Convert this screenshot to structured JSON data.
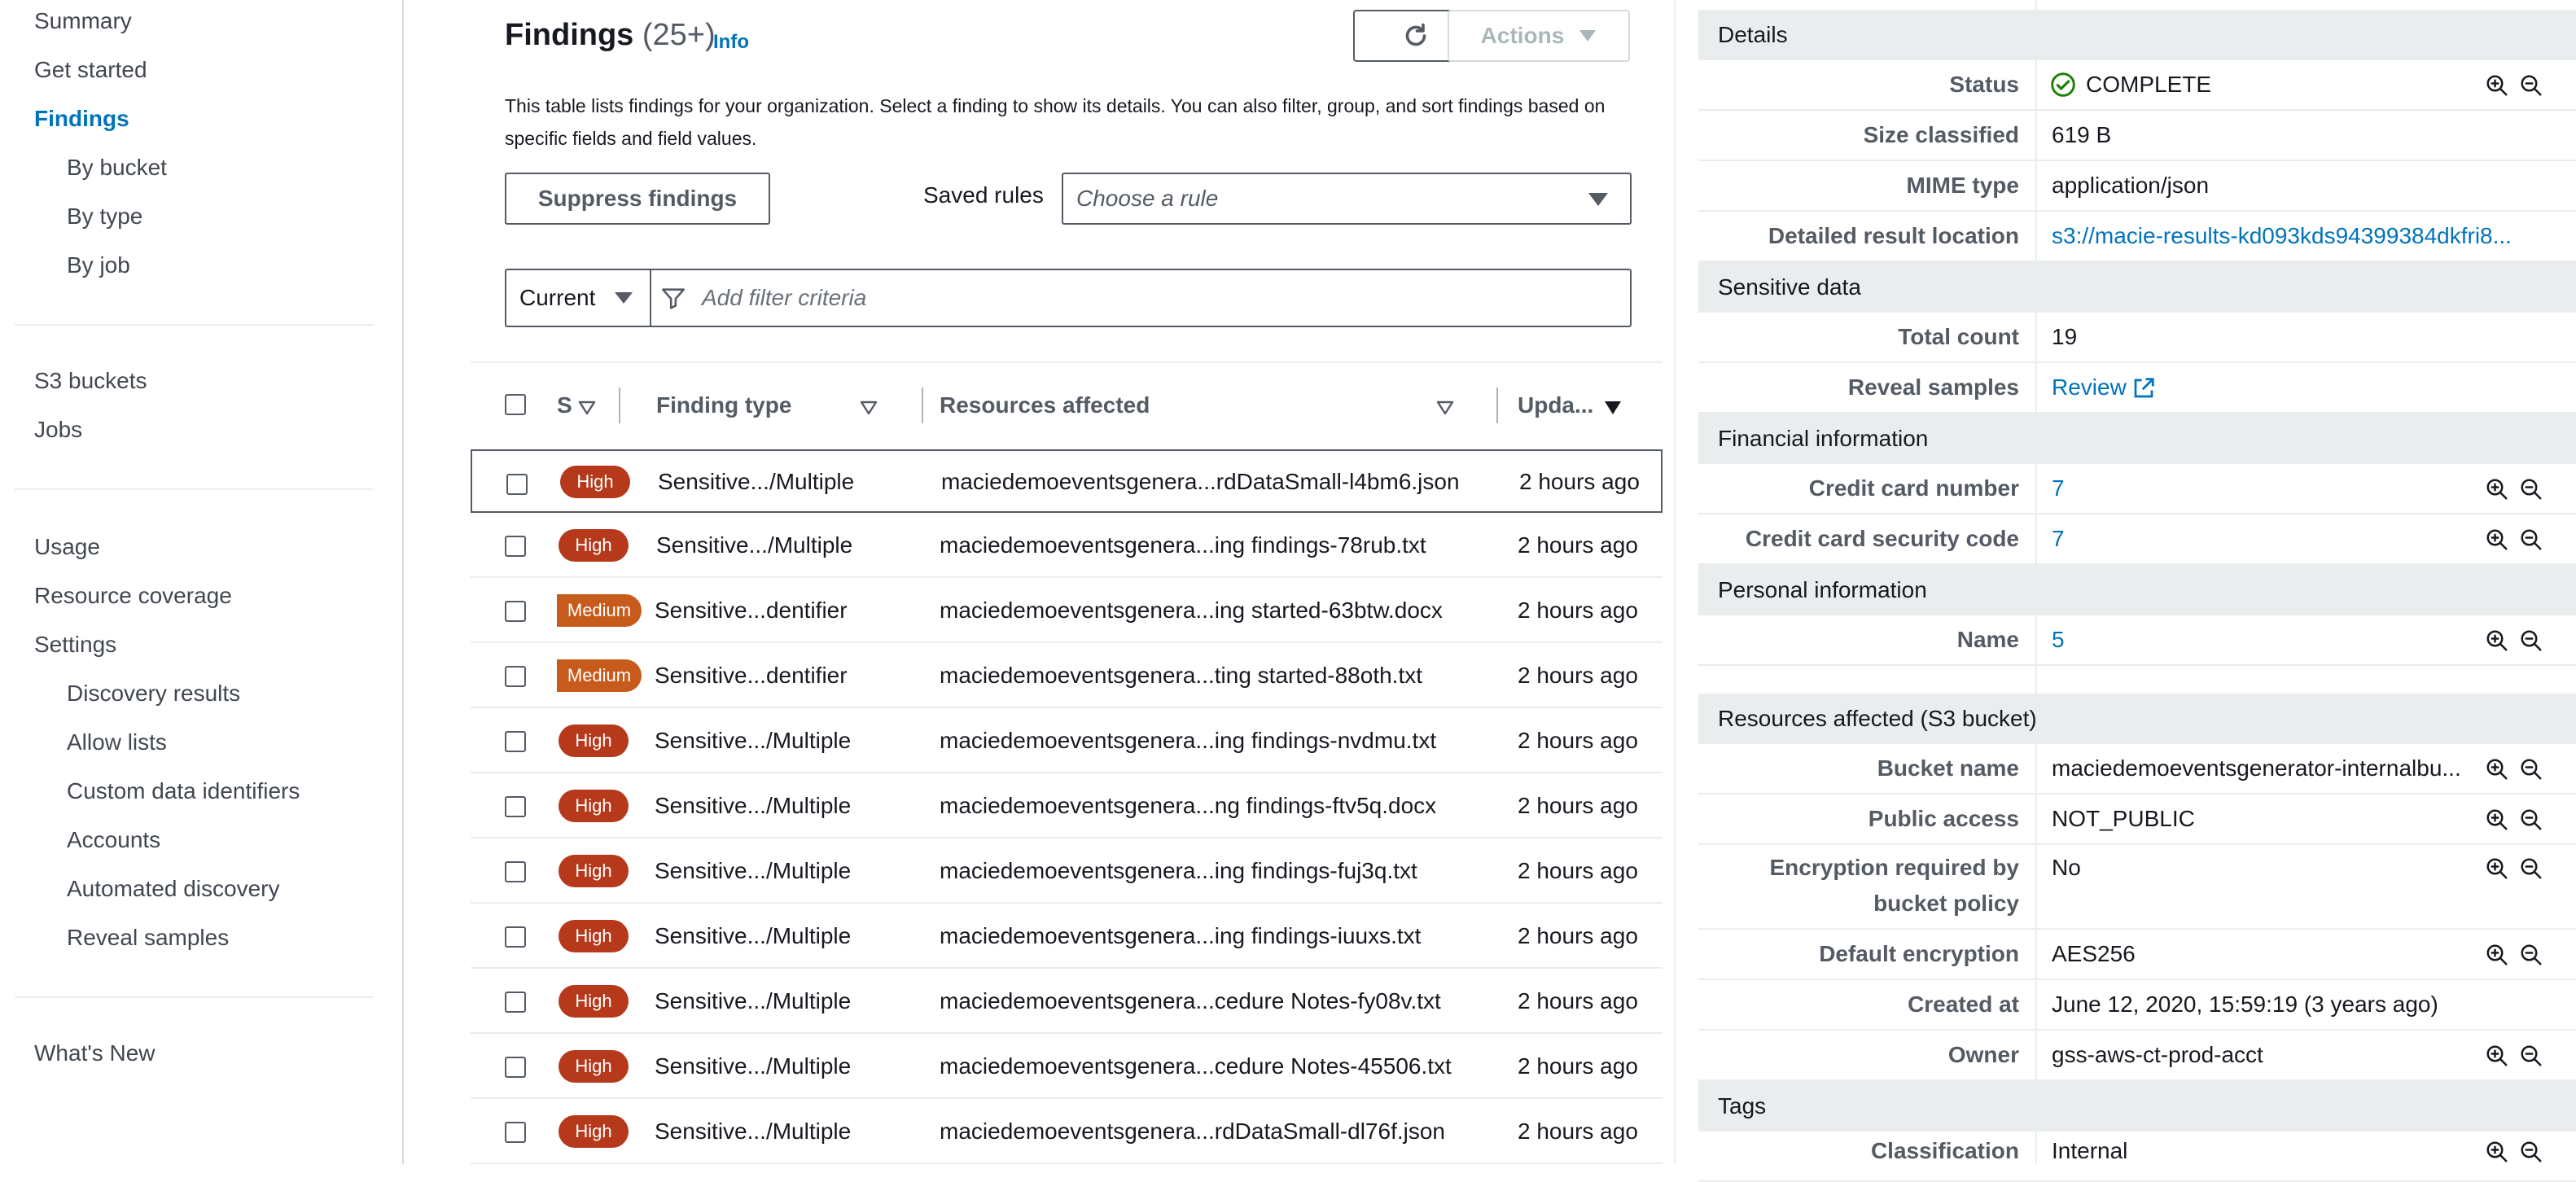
{
  "sidebar": {
    "items": [
      {
        "label": "Summary"
      },
      {
        "label": "Get started"
      },
      {
        "label": "Findings"
      },
      {
        "label": "By bucket"
      },
      {
        "label": "By type"
      },
      {
        "label": "By job"
      },
      {
        "label": "S3 buckets"
      },
      {
        "label": "Jobs"
      },
      {
        "label": "Usage"
      },
      {
        "label": "Resource coverage"
      },
      {
        "label": "Settings"
      },
      {
        "label": "Discovery results"
      },
      {
        "label": "Allow lists"
      },
      {
        "label": "Custom data identifiers"
      },
      {
        "label": "Accounts"
      },
      {
        "label": "Automated discovery"
      },
      {
        "label": "Reveal samples"
      },
      {
        "label": "What's New"
      }
    ]
  },
  "header": {
    "title": "Findings",
    "count": "(25+)",
    "info": "Info",
    "actions_label": "Actions",
    "description": "This table lists findings for your organization. Select a finding to show its details. You can also filter, group, and sort findings based on specific fields and field values."
  },
  "toolbar": {
    "suppress_label": "Suppress findings",
    "saved_rules_label": "Saved rules",
    "rule_placeholder": "Choose a rule",
    "current_label": "Current",
    "filter_placeholder": "Add filter criteria"
  },
  "table": {
    "columns": [
      "S",
      "Finding type",
      "Resources affected",
      "Upda..."
    ],
    "rows": [
      {
        "severity": "High",
        "type": "Sensitive.../Multiple",
        "resource": "maciedemoeventsgenera...rdDataSmall-l4bm6.json",
        "updated": "2 hours ago"
      },
      {
        "severity": "High",
        "type": "Sensitive.../Multiple",
        "resource": "maciedemoeventsgenera...ing findings-78rub.txt",
        "updated": "2 hours ago"
      },
      {
        "severity": "Medium",
        "type": "Sensitive...dentifier",
        "resource": "maciedemoeventsgenera...ing started-63btw.docx",
        "updated": "2 hours ago"
      },
      {
        "severity": "Medium",
        "type": "Sensitive...dentifier",
        "resource": "maciedemoeventsgenera...ting started-88oth.txt",
        "updated": "2 hours ago"
      },
      {
        "severity": "High",
        "type": "Sensitive.../Multiple",
        "resource": "maciedemoeventsgenera...ing findings-nvdmu.txt",
        "updated": "2 hours ago"
      },
      {
        "severity": "High",
        "type": "Sensitive.../Multiple",
        "resource": "maciedemoeventsgenera...ng findings-ftv5q.docx",
        "updated": "2 hours ago"
      },
      {
        "severity": "High",
        "type": "Sensitive.../Multiple",
        "resource": "maciedemoeventsgenera...ing findings-fuj3q.txt",
        "updated": "2 hours ago"
      },
      {
        "severity": "High",
        "type": "Sensitive.../Multiple",
        "resource": "maciedemoeventsgenera...ing findings-iuuxs.txt",
        "updated": "2 hours ago"
      },
      {
        "severity": "High",
        "type": "Sensitive.../Multiple",
        "resource": "maciedemoeventsgenera...cedure Notes-fy08v.txt",
        "updated": "2 hours ago"
      },
      {
        "severity": "High",
        "type": "Sensitive.../Multiple",
        "resource": "maciedemoeventsgenera...cedure Notes-45506.txt",
        "updated": "2 hours ago"
      },
      {
        "severity": "High",
        "type": "Sensitive.../Multiple",
        "resource": "maciedemoeventsgenera...rdDataSmall-dl76f.json",
        "updated": "2 hours ago"
      }
    ]
  },
  "details": {
    "sections": {
      "details": "Details",
      "sensitive": "Sensitive data",
      "financial": "Financial information",
      "personal": "Personal information",
      "resources": "Resources affected (S3 bucket)",
      "tags": "Tags"
    },
    "status": {
      "label": "Status",
      "value": "COMPLETE"
    },
    "size": {
      "label": "Size classified",
      "value": "619 B"
    },
    "mime": {
      "label": "MIME type",
      "value": "application/json"
    },
    "location": {
      "label": "Detailed result location",
      "value": "s3://macie-results-kd093kds94399384dkfri8..."
    },
    "total": {
      "label": "Total count",
      "value": "19"
    },
    "reveal": {
      "label": "Reveal samples",
      "value": "Review"
    },
    "cc_number": {
      "label": "Credit card number",
      "value": "7"
    },
    "cc_code": {
      "label": "Credit card security code",
      "value": "7"
    },
    "name": {
      "label": "Name",
      "value": "5"
    },
    "bucket": {
      "label": "Bucket name",
      "value": "maciedemoeventsgenerator-internalbu..."
    },
    "public": {
      "label": "Public access",
      "value": "NOT_PUBLIC"
    },
    "encryption_req": {
      "label_1": "Encryption required by",
      "label_2": "bucket policy",
      "value": "No"
    },
    "default_enc": {
      "label": "Default encryption",
      "value": "AES256"
    },
    "created": {
      "label": "Created at",
      "value": "June 12, 2020, 15:59:19 (3 years ago)"
    },
    "owner": {
      "label": "Owner",
      "value": "gss-aws-ct-prod-acct"
    },
    "classification": {
      "label": "Classification",
      "value": "Internal"
    }
  },
  "colors": {
    "high": "#b5391a",
    "medium": "#c65b1b",
    "link": "#0073bb",
    "success": "#1d8102"
  }
}
